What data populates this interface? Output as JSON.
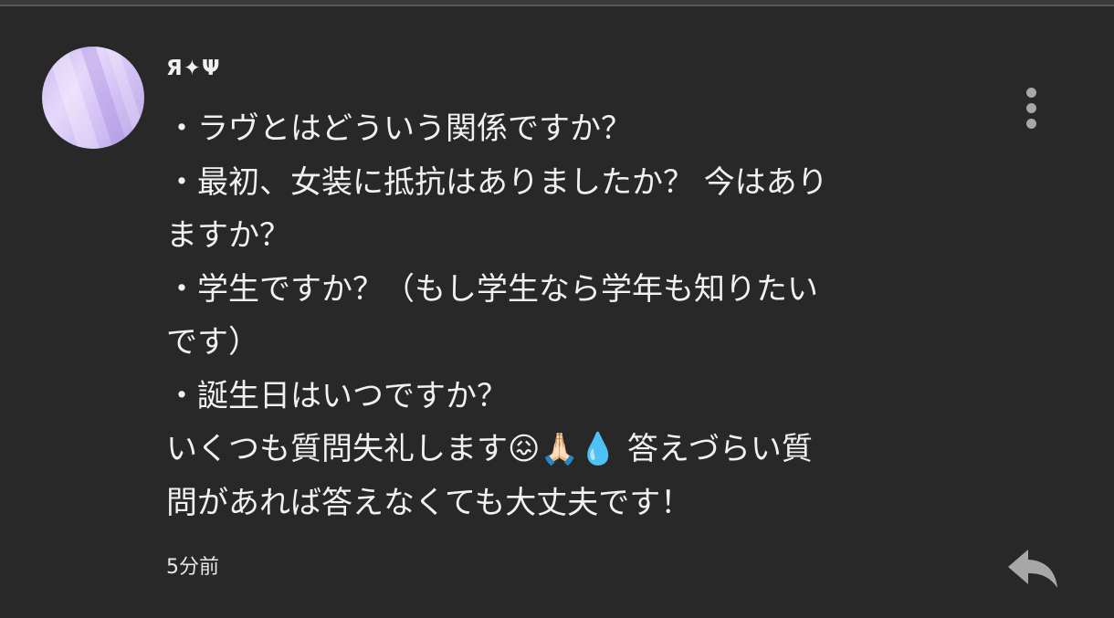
{
  "comment": {
    "author": "Я✦Ψ",
    "lines": [
      "・ラヴとはどういう関係ですか？",
      "・最初、女装に抵抗はありましたか？ 今はあり",
      "ますか？",
      "・学生ですか？（もし学生なら学年も知りたい",
      "です）",
      "・誕生日はいつですか？",
      "いくつも質問失礼します😖🙏🏻💧 答えづらい質",
      "問があれば答えなくても大丈夫です！"
    ],
    "timestamp": "5分前"
  },
  "icons": {
    "menu": "more-vert-icon",
    "reply": "reply-icon"
  },
  "colors": {
    "background": "#282828",
    "text": "#f1f1f1",
    "icon": "#a7a7a7"
  }
}
